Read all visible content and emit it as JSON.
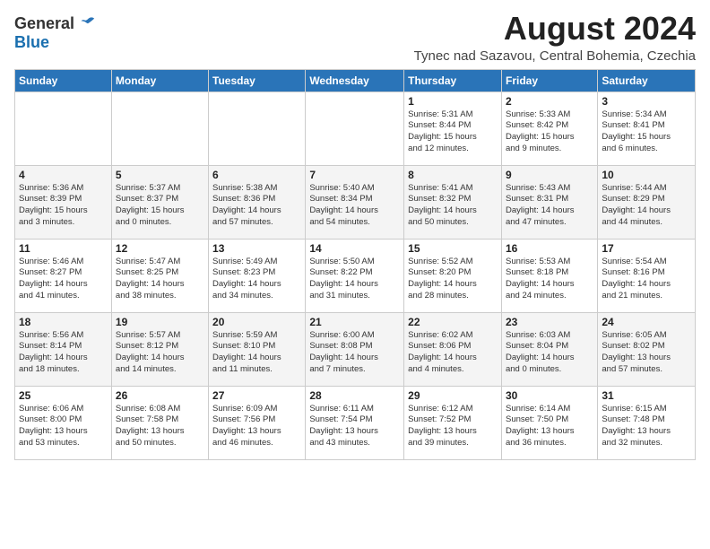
{
  "logo": {
    "general": "General",
    "blue": "Blue"
  },
  "header": {
    "month_year": "August 2024",
    "location": "Tynec nad Sazavou, Central Bohemia, Czechia"
  },
  "columns": [
    "Sunday",
    "Monday",
    "Tuesday",
    "Wednesday",
    "Thursday",
    "Friday",
    "Saturday"
  ],
  "weeks": [
    {
      "days": [
        {
          "num": "",
          "info": ""
        },
        {
          "num": "",
          "info": ""
        },
        {
          "num": "",
          "info": ""
        },
        {
          "num": "",
          "info": ""
        },
        {
          "num": "1",
          "info": "Sunrise: 5:31 AM\nSunset: 8:44 PM\nDaylight: 15 hours\nand 12 minutes."
        },
        {
          "num": "2",
          "info": "Sunrise: 5:33 AM\nSunset: 8:42 PM\nDaylight: 15 hours\nand 9 minutes."
        },
        {
          "num": "3",
          "info": "Sunrise: 5:34 AM\nSunset: 8:41 PM\nDaylight: 15 hours\nand 6 minutes."
        }
      ]
    },
    {
      "days": [
        {
          "num": "4",
          "info": "Sunrise: 5:36 AM\nSunset: 8:39 PM\nDaylight: 15 hours\nand 3 minutes."
        },
        {
          "num": "5",
          "info": "Sunrise: 5:37 AM\nSunset: 8:37 PM\nDaylight: 15 hours\nand 0 minutes."
        },
        {
          "num": "6",
          "info": "Sunrise: 5:38 AM\nSunset: 8:36 PM\nDaylight: 14 hours\nand 57 minutes."
        },
        {
          "num": "7",
          "info": "Sunrise: 5:40 AM\nSunset: 8:34 PM\nDaylight: 14 hours\nand 54 minutes."
        },
        {
          "num": "8",
          "info": "Sunrise: 5:41 AM\nSunset: 8:32 PM\nDaylight: 14 hours\nand 50 minutes."
        },
        {
          "num": "9",
          "info": "Sunrise: 5:43 AM\nSunset: 8:31 PM\nDaylight: 14 hours\nand 47 minutes."
        },
        {
          "num": "10",
          "info": "Sunrise: 5:44 AM\nSunset: 8:29 PM\nDaylight: 14 hours\nand 44 minutes."
        }
      ]
    },
    {
      "days": [
        {
          "num": "11",
          "info": "Sunrise: 5:46 AM\nSunset: 8:27 PM\nDaylight: 14 hours\nand 41 minutes."
        },
        {
          "num": "12",
          "info": "Sunrise: 5:47 AM\nSunset: 8:25 PM\nDaylight: 14 hours\nand 38 minutes."
        },
        {
          "num": "13",
          "info": "Sunrise: 5:49 AM\nSunset: 8:23 PM\nDaylight: 14 hours\nand 34 minutes."
        },
        {
          "num": "14",
          "info": "Sunrise: 5:50 AM\nSunset: 8:22 PM\nDaylight: 14 hours\nand 31 minutes."
        },
        {
          "num": "15",
          "info": "Sunrise: 5:52 AM\nSunset: 8:20 PM\nDaylight: 14 hours\nand 28 minutes."
        },
        {
          "num": "16",
          "info": "Sunrise: 5:53 AM\nSunset: 8:18 PM\nDaylight: 14 hours\nand 24 minutes."
        },
        {
          "num": "17",
          "info": "Sunrise: 5:54 AM\nSunset: 8:16 PM\nDaylight: 14 hours\nand 21 minutes."
        }
      ]
    },
    {
      "days": [
        {
          "num": "18",
          "info": "Sunrise: 5:56 AM\nSunset: 8:14 PM\nDaylight: 14 hours\nand 18 minutes."
        },
        {
          "num": "19",
          "info": "Sunrise: 5:57 AM\nSunset: 8:12 PM\nDaylight: 14 hours\nand 14 minutes."
        },
        {
          "num": "20",
          "info": "Sunrise: 5:59 AM\nSunset: 8:10 PM\nDaylight: 14 hours\nand 11 minutes."
        },
        {
          "num": "21",
          "info": "Sunrise: 6:00 AM\nSunset: 8:08 PM\nDaylight: 14 hours\nand 7 minutes."
        },
        {
          "num": "22",
          "info": "Sunrise: 6:02 AM\nSunset: 8:06 PM\nDaylight: 14 hours\nand 4 minutes."
        },
        {
          "num": "23",
          "info": "Sunrise: 6:03 AM\nSunset: 8:04 PM\nDaylight: 14 hours\nand 0 minutes."
        },
        {
          "num": "24",
          "info": "Sunrise: 6:05 AM\nSunset: 8:02 PM\nDaylight: 13 hours\nand 57 minutes."
        }
      ]
    },
    {
      "days": [
        {
          "num": "25",
          "info": "Sunrise: 6:06 AM\nSunset: 8:00 PM\nDaylight: 13 hours\nand 53 minutes."
        },
        {
          "num": "26",
          "info": "Sunrise: 6:08 AM\nSunset: 7:58 PM\nDaylight: 13 hours\nand 50 minutes."
        },
        {
          "num": "27",
          "info": "Sunrise: 6:09 AM\nSunset: 7:56 PM\nDaylight: 13 hours\nand 46 minutes."
        },
        {
          "num": "28",
          "info": "Sunrise: 6:11 AM\nSunset: 7:54 PM\nDaylight: 13 hours\nand 43 minutes."
        },
        {
          "num": "29",
          "info": "Sunrise: 6:12 AM\nSunset: 7:52 PM\nDaylight: 13 hours\nand 39 minutes."
        },
        {
          "num": "30",
          "info": "Sunrise: 6:14 AM\nSunset: 7:50 PM\nDaylight: 13 hours\nand 36 minutes."
        },
        {
          "num": "31",
          "info": "Sunrise: 6:15 AM\nSunset: 7:48 PM\nDaylight: 13 hours\nand 32 minutes."
        }
      ]
    }
  ]
}
